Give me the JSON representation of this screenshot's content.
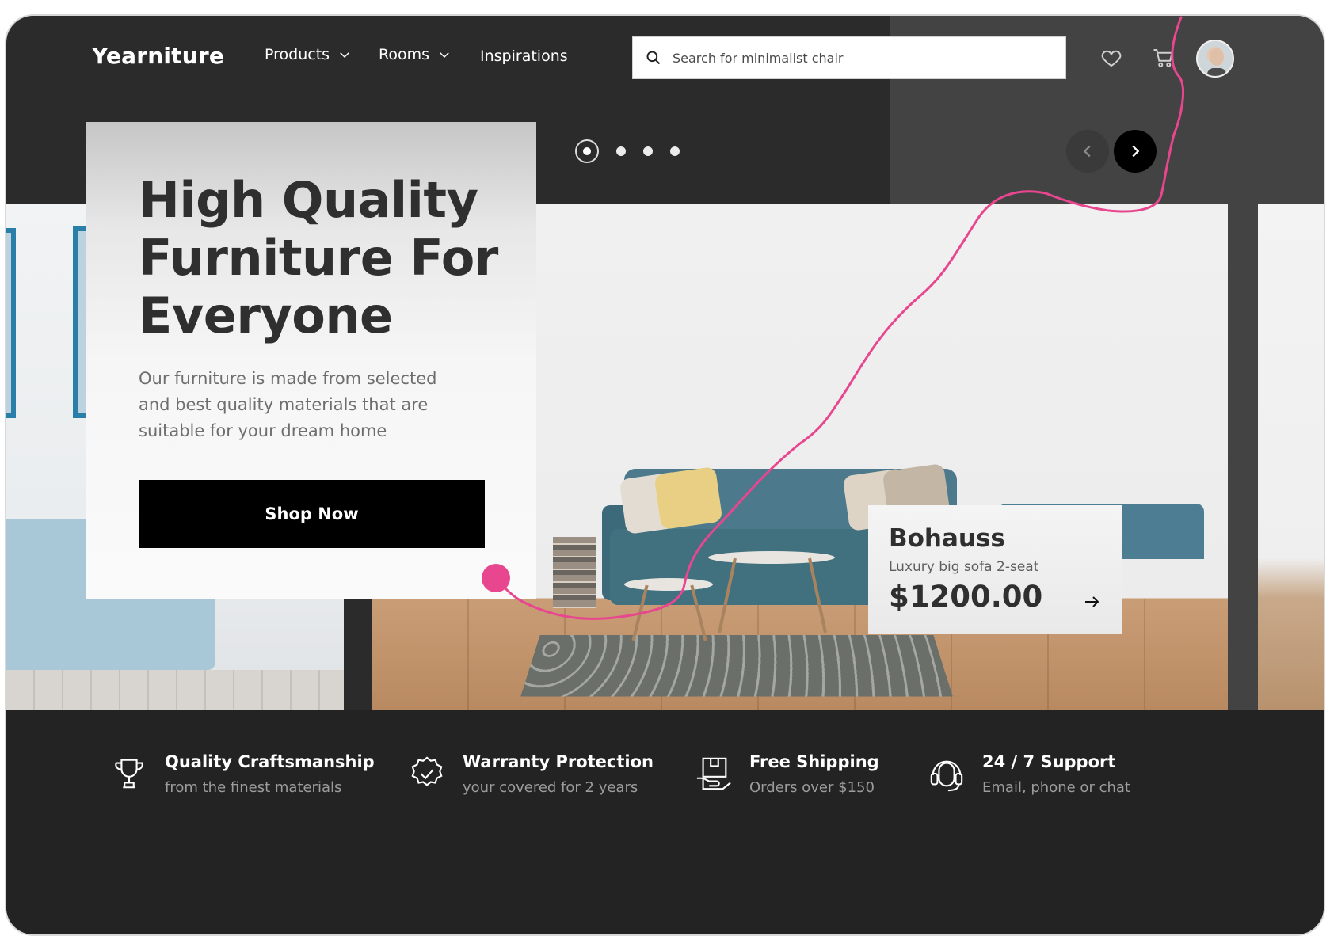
{
  "header": {
    "logo": "Yearniture",
    "nav": [
      {
        "label": "Products",
        "has_dropdown": true
      },
      {
        "label": "Rooms",
        "has_dropdown": true
      },
      {
        "label": "Inspirations",
        "has_dropdown": false
      }
    ],
    "search": {
      "placeholder": "Search for minimalist chair",
      "icon": "search-icon"
    },
    "icons": [
      "heart-icon",
      "cart-icon",
      "avatar"
    ]
  },
  "hero": {
    "title": "High Quality Furniture For Everyone",
    "subtitle": "Our furniture is made from selected and best quality materials that are suitable for your dream home",
    "cta_label": "Shop Now",
    "carousel": {
      "slides": 4,
      "active": 1
    }
  },
  "product_card": {
    "name": "Bohauss",
    "description": "Luxury big sofa 2-seat",
    "price": "$1200.00"
  },
  "features": [
    {
      "icon": "trophy-icon",
      "title": "Quality Craftsmanship",
      "subtitle": "from the finest materials"
    },
    {
      "icon": "badge-check-icon",
      "title": "Warranty Protection",
      "subtitle": "your covered for 2 years"
    },
    {
      "icon": "box-hand-icon",
      "title": "Free Shipping",
      "subtitle": "Orders over $150"
    },
    {
      "icon": "headset-icon",
      "title": "24 / 7 Support",
      "subtitle": "Email, phone or chat"
    }
  ],
  "colors": {
    "frame_dark": "#2b2b2b",
    "header_panel": "#434343",
    "features_band": "#232323",
    "annotation_stroke": "#e8468f"
  }
}
